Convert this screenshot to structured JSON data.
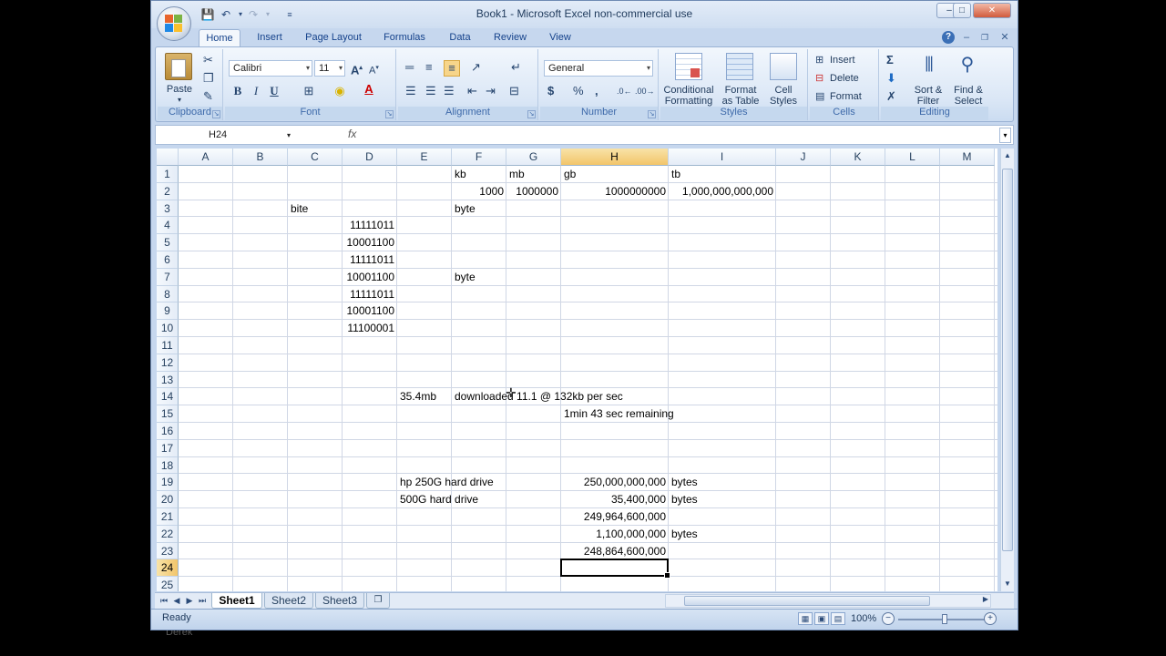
{
  "window": {
    "title": "Book1 - Microsoft Excel non-commercial use"
  },
  "tabs": [
    "Home",
    "Insert",
    "Page Layout",
    "Formulas",
    "Data",
    "Review",
    "View"
  ],
  "ribbon": {
    "clipboard": {
      "paste": "Paste",
      "label": "Clipboard"
    },
    "font": {
      "name": "Calibri",
      "size": "11",
      "label": "Font",
      "bold": "B",
      "italic": "I",
      "underline": "U"
    },
    "alignment": {
      "label": "Alignment"
    },
    "number": {
      "format": "General",
      "currency": "$",
      "percent": "%",
      "comma": ",",
      "label": "Number"
    },
    "styles": {
      "conditional": [
        "Conditional",
        "Formatting"
      ],
      "format_table": [
        "Format",
        "as Table"
      ],
      "cell_styles": [
        "Cell",
        "Styles"
      ],
      "label": "Styles"
    },
    "cells": {
      "insert": "Insert",
      "delete": "Delete",
      "format": "Format",
      "label": "Cells"
    },
    "editing": {
      "sort": [
        "Sort &",
        "Filter"
      ],
      "find": [
        "Find &",
        "Select"
      ],
      "label": "Editing"
    }
  },
  "formula_bar": {
    "name_box": "H24",
    "fx": "fx",
    "formula": ""
  },
  "columns": [
    "A",
    "B",
    "C",
    "D",
    "E",
    "F",
    "G",
    "H",
    "I",
    "J",
    "K",
    "L",
    "M"
  ],
  "rows": [
    "1",
    "2",
    "3",
    "4",
    "5",
    "6",
    "7",
    "8",
    "9",
    "10",
    "11",
    "12",
    "13",
    "14",
    "15",
    "16",
    "17",
    "18",
    "19",
    "20",
    "21",
    "22",
    "23",
    "24",
    "25"
  ],
  "cells": {
    "F1": "kb",
    "G1": "mb",
    "H1": "gb",
    "I1": "tb",
    "F2": "1000",
    "G2": "1000000",
    "H2": "1000000000",
    "I2": "1,000,000,000,000",
    "C3": "bite",
    "F3": "byte",
    "D4": "11111011",
    "D5": "10001100",
    "D6": "11111011",
    "D7": "10001100",
    "F7": "byte",
    "D8": "11111011",
    "D9": "10001100",
    "D10": "11100001",
    "E14": "35.4mb",
    "F14": "downloaded 11.1 @ 132kb per sec",
    "H15": "1min 43 sec remaining",
    "E19": "hp 250G hard drive",
    "H19": "250,000,000,000",
    "I19": "bytes",
    "E20": "500G hard drive",
    "H20": "35,400,000",
    "I20": "bytes",
    "H21": "249,964,600,000",
    "H22": "1,100,000,000",
    "I22": "bytes",
    "H23": "248,864,600,000"
  },
  "active_cell": "H24",
  "sheets": [
    "Sheet1",
    "Sheet2",
    "Sheet3"
  ],
  "active_sheet": "Sheet1",
  "status": {
    "text": "Ready",
    "zoom": "100%"
  },
  "background_caption": "Derek"
}
